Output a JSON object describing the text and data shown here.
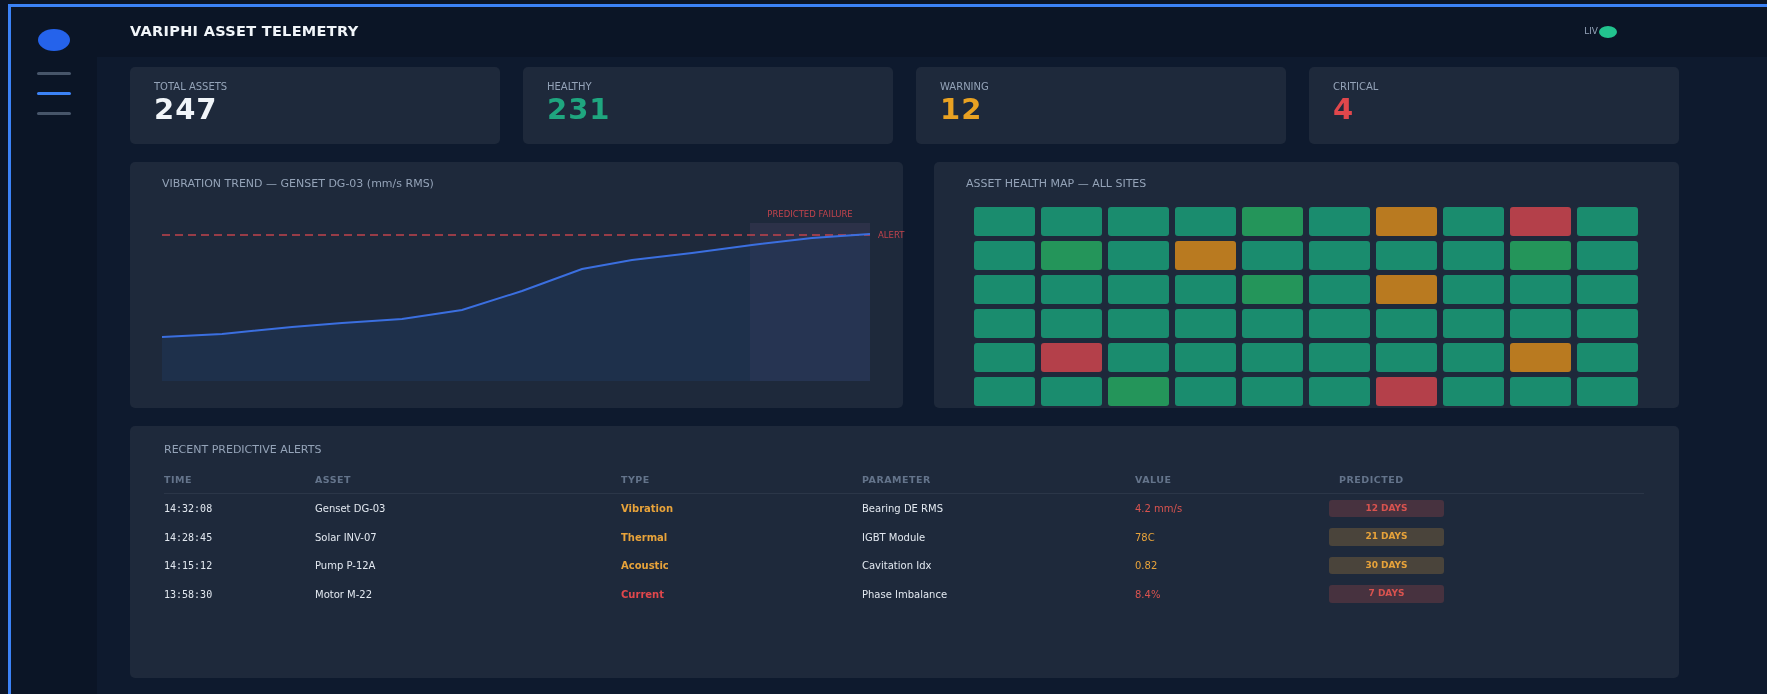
{
  "sidebar": {
    "items": [
      {
        "selected": false
      },
      {
        "selected": true
      },
      {
        "selected": false
      }
    ]
  },
  "header": {
    "title": "VARIPHI ASSET TELEMETRY",
    "live_label": "LIV"
  },
  "kpis": [
    {
      "label": "TOTAL ASSETS",
      "value": "247",
      "color": "#f1f5f9"
    },
    {
      "label": "HEALTHY",
      "value": "231",
      "color": "#1fa67f"
    },
    {
      "label": "WARNING",
      "value": "12",
      "color": "#e8a122"
    },
    {
      "label": "CRITICAL",
      "value": "4",
      "color": "#e0474c"
    }
  ],
  "trend": {
    "title": "VIBRATION TREND — GENSET DG-03 (mm/s RMS)",
    "predicted_label": "PREDICTED FAILURE",
    "alert_label": "ALERT"
  },
  "health_map": {
    "title": "ASSET HEALTH MAP — ALL SITES",
    "rows": [
      [
        {
          "color": "#1a8c6e"
        },
        {
          "color": "#1a8c6e"
        },
        {
          "color": "#1a8c6e"
        },
        {
          "color": "#1a8c6e"
        },
        {
          "color": "#24955a"
        },
        {
          "color": "#1a8c6e"
        },
        {
          "color": "#b97a20"
        },
        {
          "color": "#1a8c6e"
        },
        {
          "color": "#b4404a"
        },
        {
          "color": "#1a8c6e"
        }
      ],
      [
        {
          "color": "#1a8c6e"
        },
        {
          "color": "#24955a"
        },
        {
          "color": "#1a8c6e"
        },
        {
          "color": "#b97a20"
        },
        {
          "color": "#1a8c6e"
        },
        {
          "color": "#1a8c6e"
        },
        {
          "color": "#1a8c6e"
        },
        {
          "color": "#1a8c6e"
        },
        {
          "color": "#24955a"
        },
        {
          "color": "#1a8c6e"
        }
      ],
      [
        {
          "color": "#1a8c6e"
        },
        {
          "color": "#1a8c6e"
        },
        {
          "color": "#1a8c6e"
        },
        {
          "color": "#1a8c6e"
        },
        {
          "color": "#24955a"
        },
        {
          "color": "#1a8c6e"
        },
        {
          "color": "#b97a20"
        },
        {
          "color": "#1a8c6e"
        },
        {
          "color": "#1a8c6e"
        },
        {
          "color": "#1a8c6e"
        }
      ],
      [
        {
          "color": "#1a8c6e"
        },
        {
          "color": "#1a8c6e"
        },
        {
          "color": "#1a8c6e"
        },
        {
          "color": "#1a8c6e"
        },
        {
          "color": "#1a8c6e"
        },
        {
          "color": "#1a8c6e"
        },
        {
          "color": "#1a8c6e"
        },
        {
          "color": "#1a8c6e"
        },
        {
          "color": "#1a8c6e"
        },
        {
          "color": "#1a8c6e"
        }
      ],
      [
        {
          "color": "#1a8c6e"
        },
        {
          "color": "#b4404a"
        },
        {
          "color": "#1a8c6e"
        },
        {
          "color": "#1a8c6e"
        },
        {
          "color": "#1a8c6e"
        },
        {
          "color": "#1a8c6e"
        },
        {
          "color": "#1a8c6e"
        },
        {
          "color": "#1a8c6e"
        },
        {
          "color": "#b97a20"
        },
        {
          "color": "#1a8c6e"
        }
      ],
      [
        {
          "color": "#1a8c6e"
        },
        {
          "color": "#1a8c6e"
        },
        {
          "color": "#24955a"
        },
        {
          "color": "#1a8c6e"
        },
        {
          "color": "#1a8c6e"
        },
        {
          "color": "#1a8c6e"
        },
        {
          "color": "#b4404a"
        },
        {
          "color": "#1a8c6e"
        },
        {
          "color": "#1a8c6e"
        },
        {
          "color": "#1a8c6e"
        }
      ]
    ]
  },
  "alerts": {
    "title": "RECENT PREDICTIVE ALERTS",
    "columns": [
      "TIME",
      "ASSET",
      "TYPE",
      "PARAMETER",
      "VALUE",
      "PREDICTED"
    ],
    "rows": [
      {
        "time": "14:32:08",
        "asset": "Genset DG-03",
        "type": {
          "text": "Vibration",
          "color": "#e8a33a"
        },
        "parameter": "Bearing DE RMS",
        "value": {
          "text": "4.2 mm/s",
          "color": "#d9534f"
        },
        "predicted": {
          "text": "12 DAYS",
          "color": "#d9534f"
        }
      },
      {
        "time": "14:28:45",
        "asset": "Solar INV-07",
        "type": {
          "text": "Thermal",
          "color": "#e8a33a"
        },
        "parameter": "IGBT Module",
        "value": {
          "text": "78C",
          "color": "#e8a33a"
        },
        "predicted": {
          "text": "21 DAYS",
          "color": "#e8a33a"
        }
      },
      {
        "time": "14:15:12",
        "asset": "Pump P-12A",
        "type": {
          "text": "Acoustic",
          "color": "#e8a33a"
        },
        "parameter": "Cavitation Idx",
        "value": {
          "text": "0.82",
          "color": "#e8a33a"
        },
        "predicted": {
          "text": "30 DAYS",
          "color": "#e8a33a"
        }
      },
      {
        "time": "13:58:30",
        "asset": "Motor M-22",
        "type": {
          "text": "Current",
          "color": "#e0474c"
        },
        "parameter": "Phase Imbalance",
        "value": {
          "text": "8.4%",
          "color": "#d9534f"
        },
        "predicted": {
          "text": "7 DAYS",
          "color": "#d9534f"
        }
      }
    ]
  }
}
